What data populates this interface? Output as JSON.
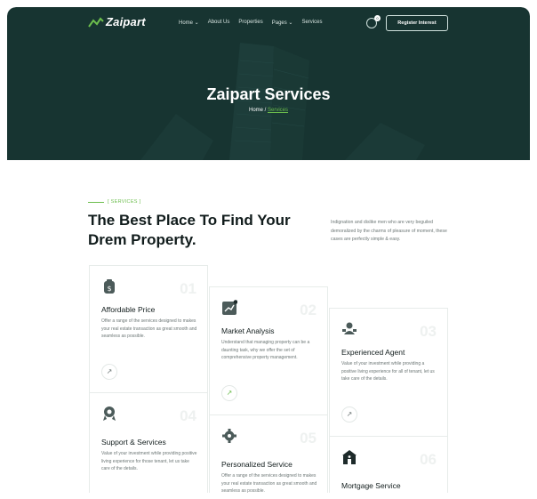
{
  "brand": {
    "name": "Zaipart"
  },
  "nav": {
    "items": [
      "Home ⌄",
      "About Us",
      "Properties",
      "Pages ⌄",
      "Services"
    ],
    "cart_count": "0",
    "cta": "Register Interest"
  },
  "hero": {
    "title": "Zaipart Services",
    "breadcrumb_home": "Home /",
    "breadcrumb_current": "Services"
  },
  "section": {
    "tag": "[ SERVICES ]",
    "heading": "The Best Place To Find Your Drem Property.",
    "intro": "Indignation and dislike men who are very beguiled demoralized by the charms of pleasure of moment, these cases are perfectly simple & easy."
  },
  "cards": [
    {
      "num": "01",
      "title": "Affordable Price",
      "icon": "money-bag-icon",
      "desc": "Offer a range of the services designed to makes your real estate transaction as great smooth and seamless as possible."
    },
    {
      "num": "02",
      "title": "Market Analysis",
      "icon": "chart-icon",
      "desc": "Understand that managing property can be a daunting task, why we offer the set of comprehensive property management."
    },
    {
      "num": "03",
      "title": "Experienced Agent",
      "icon": "agents-icon",
      "desc": "Value of your investment while providing a positive living experience for all of tenant, let us take care of the details."
    },
    {
      "num": "04",
      "title": "Support & Services",
      "icon": "award-icon",
      "desc": "Value of your investment while providing positive living experience for those tenant, let us take care of the details."
    },
    {
      "num": "05",
      "title": "Personalized Service",
      "icon": "gear-icon",
      "desc": "Offer a range of the services designed to makes your real estate transaction as great smooth and seamless as possible."
    },
    {
      "num": "06",
      "title": "Mortgage Service",
      "icon": "bank-icon",
      "desc": ""
    }
  ],
  "arrow_glyph": "↗",
  "colors": {
    "hero_bg": "#173431",
    "accent": "#6cbd4d",
    "icon": "#4c5b5a"
  }
}
